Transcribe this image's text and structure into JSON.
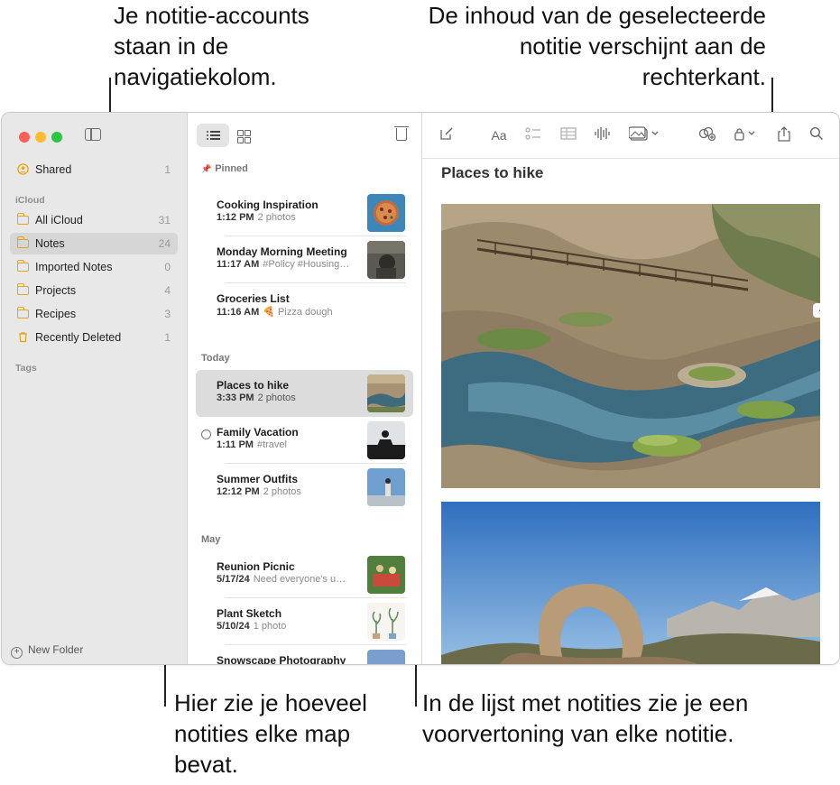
{
  "callouts": {
    "top_left": [
      "Je notitie-accounts",
      "staan in de",
      "navigatiekolom."
    ],
    "top_right": [
      "De inhoud van de geselecteerde",
      "notitie verschijnt aan de",
      "rechterkant."
    ],
    "bottom_left": [
      "Hier zie je hoeveel",
      "notities elke map",
      "bevat."
    ],
    "bottom_right": [
      "In de lijst met notities zie je een",
      "voorvertoning van elke notitie."
    ]
  },
  "sidebar": {
    "shared": {
      "label": "Shared",
      "count": "1"
    },
    "section_icloud": "iCloud",
    "folders": [
      {
        "label": "All iCloud",
        "count": "31"
      },
      {
        "label": "Notes",
        "count": "24"
      },
      {
        "label": "Imported Notes",
        "count": "0"
      },
      {
        "label": "Projects",
        "count": "4"
      },
      {
        "label": "Recipes",
        "count": "3"
      },
      {
        "label": "Recently Deleted",
        "count": "1"
      }
    ],
    "section_tags": "Tags",
    "new_folder": "New Folder"
  },
  "notelist": {
    "sections": {
      "pinned": "Pinned",
      "today": "Today",
      "may": "May"
    },
    "notes": [
      {
        "title": "Cooking Inspiration",
        "time": "1:12 PM",
        "preview": "2 photos"
      },
      {
        "title": "Monday Morning Meeting",
        "time": "11:17 AM",
        "preview": "#Policy #Housing…"
      },
      {
        "title": "Groceries List",
        "time": "11:16 AM",
        "preview": "🍕 Pizza dough"
      },
      {
        "title": "Places to hike",
        "time": "3:33 PM",
        "preview": "2 photos"
      },
      {
        "title": "Family Vacation",
        "time": "1:11 PM",
        "preview": "#travel"
      },
      {
        "title": "Summer Outfits",
        "time": "12:12 PM",
        "preview": "2 photos"
      },
      {
        "title": "Reunion Picnic",
        "time": "5/17/24",
        "preview": "Need everyone's u…"
      },
      {
        "title": "Plant Sketch",
        "time": "5/10/24",
        "preview": "1 photo"
      },
      {
        "title": "Snowscape Photography",
        "time": "",
        "preview": ""
      }
    ]
  },
  "editor": {
    "toolbar": {
      "format_label": "Aa"
    },
    "title": "Places to hike"
  },
  "colors": {
    "accent_folder": "#e4a41c",
    "selection": "#dcdcdc"
  }
}
